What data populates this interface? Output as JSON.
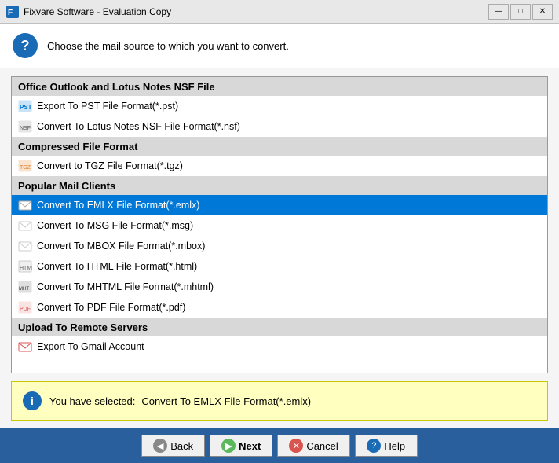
{
  "titlebar": {
    "icon": "🛠",
    "title": "Fixvare Software - Evaluation Copy",
    "min_label": "—",
    "max_label": "□",
    "close_label": "✕"
  },
  "header": {
    "icon": "?",
    "text": "Choose the mail source to which you want to convert."
  },
  "list": {
    "items": [
      {
        "id": "group-1",
        "type": "group",
        "label": "Office Outlook and Lotus Notes NSF File",
        "icon": ""
      },
      {
        "id": "item-pst",
        "type": "item",
        "label": "Export To PST File Format(*.pst)",
        "icon": "pst"
      },
      {
        "id": "item-nsf",
        "type": "item",
        "label": "Convert To Lotus Notes NSF File Format(*.nsf)",
        "icon": "nsf"
      },
      {
        "id": "group-2",
        "type": "group",
        "label": "Compressed File Format",
        "icon": ""
      },
      {
        "id": "item-tgz",
        "type": "item",
        "label": "Convert to TGZ File Format(*.tgz)",
        "icon": "tgz"
      },
      {
        "id": "group-3",
        "type": "group",
        "label": "Popular Mail Clients",
        "icon": ""
      },
      {
        "id": "item-emlx",
        "type": "item",
        "label": "Convert To EMLX File Format(*.emlx)",
        "icon": "emlx",
        "selected": true
      },
      {
        "id": "item-msg",
        "type": "item",
        "label": "Convert To MSG File Format(*.msg)",
        "icon": "msg"
      },
      {
        "id": "item-mbox",
        "type": "item",
        "label": "Convert To MBOX File Format(*.mbox)",
        "icon": "mbox"
      },
      {
        "id": "item-html",
        "type": "item",
        "label": "Convert To HTML File Format(*.html)",
        "icon": "html"
      },
      {
        "id": "item-mhtml",
        "type": "item",
        "label": "Convert To MHTML File Format(*.mhtml)",
        "icon": "mhtml"
      },
      {
        "id": "item-pdf",
        "type": "item",
        "label": "Convert To PDF File Format(*.pdf)",
        "icon": "pdf"
      },
      {
        "id": "group-4",
        "type": "group",
        "label": "Upload To Remote Servers",
        "icon": ""
      },
      {
        "id": "item-gmail",
        "type": "item",
        "label": "Export To Gmail Account",
        "icon": "gmail"
      }
    ]
  },
  "info": {
    "icon": "i",
    "text": "You have selected:- Convert To EMLX File Format(*.emlx)"
  },
  "buttons": {
    "back": "Back",
    "next": "Next",
    "cancel": "Cancel",
    "help": "Help"
  }
}
